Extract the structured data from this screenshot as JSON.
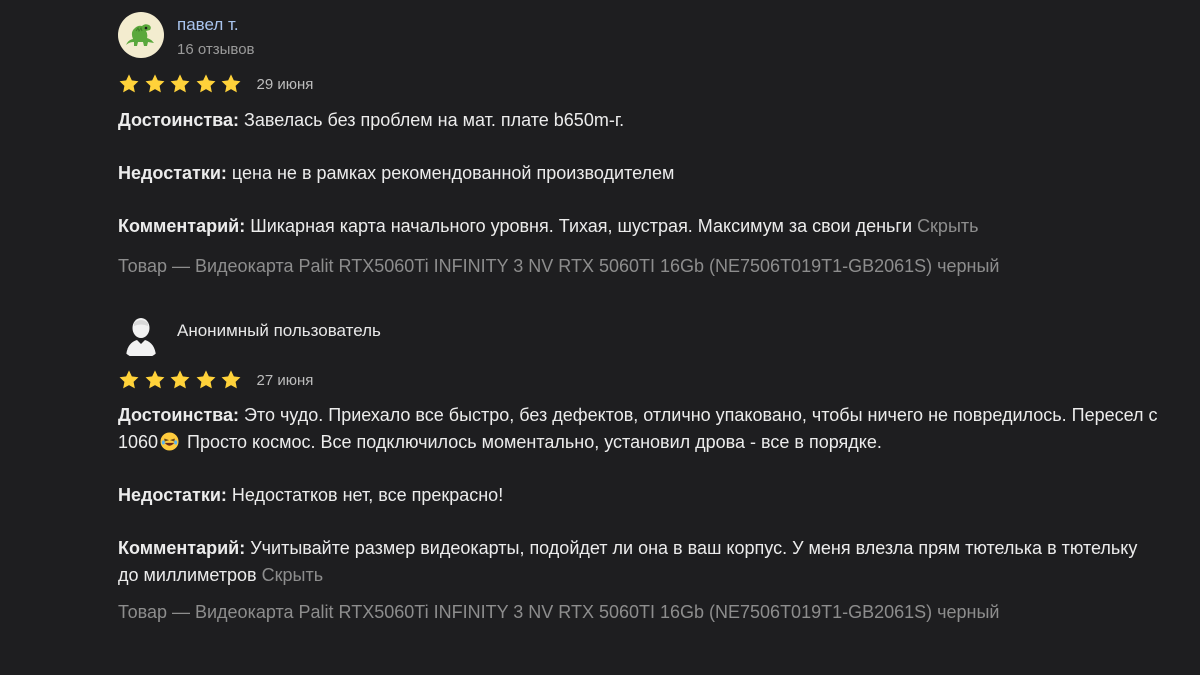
{
  "reviews": [
    {
      "author_name": "павел т.",
      "author_sub": "16 отзывов",
      "avatar": "dinosaur-avatar-icon",
      "rating": 5,
      "date": "29 июня",
      "pros_label": "Достоинства:",
      "pros_text": " Завелась без проблем на мат. плате b650m-г.",
      "cons_label": "Недостатки:",
      "cons_text": " цена не в рамках рекомендованной производителем",
      "comment_label": "Комментарий:",
      "comment_text": " Шикарная карта начального уровня. Тихая, шустрая. Максимум за свои деньги",
      "hide_label": "Скрыть",
      "product": "Товар — Видеокарта Palit RTX5060Ti INFINITY 3 NV RTX 5060TI 16Gb (NE7506T019T1-GB2061S) черный"
    },
    {
      "author_name": "Анонимный пользователь",
      "avatar": "anonymous-user-icon",
      "rating": 5,
      "date": "27 июня",
      "pros_label": "Достоинства:",
      "pros_text_1": " Это чудо. Приехало все быстро, без дефектов, отлично упаковано, чтобы ничего не повредилось. Пересел с 1060",
      "pros_emoji": "laughing-face-emoji",
      "pros_text_2": " Просто космос. Все подключилось моментально, установил дрова - все в порядке.",
      "cons_label": "Недостатки:",
      "cons_text": " Недостатков нет, все прекрасно!",
      "comment_label": "Комментарий:",
      "comment_text": " Учитывайте размер видеокарты, подойдет ли она в ваш корпус. У меня влезла прям тютелька в тютельку до миллиметров",
      "hide_label": "Скрыть",
      "product": "Товар — Видеокарта Palit RTX5060Ti INFINITY 3 NV RTX 5060TI 16Gb (NE7506T019T1-GB2061S) черный"
    }
  ],
  "colors": {
    "background": "#1e1e20",
    "star": "#ffd23a",
    "author_link": "#a9c4ee",
    "muted": "#8d8d8d"
  }
}
